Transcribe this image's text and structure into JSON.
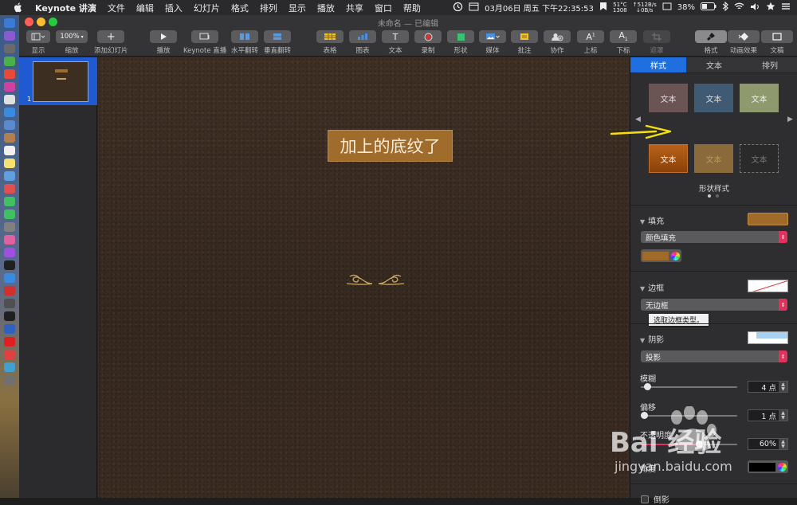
{
  "menubar": {
    "app": "Keynote 讲演",
    "items": [
      "文件",
      "编辑",
      "插入",
      "幻灯片",
      "格式",
      "排列",
      "显示",
      "播放",
      "共享",
      "窗口",
      "帮助"
    ],
    "clock": "03月06日 周五 下午22:35:53",
    "temp": "51°C",
    "rpm": "1308",
    "net_up": "↑512B/s",
    "net_down": "↓0B/s",
    "battery": "38%"
  },
  "window": {
    "title": "未命名 — 已编辑"
  },
  "toolbar": {
    "view": "显示",
    "zoom_value": "100%",
    "zoom": "缩放",
    "add_slide": "添加幻灯片",
    "play": "播放",
    "keynote_live": "Keynote 直播",
    "flip_h": "水平翻转",
    "flip_v": "垂直翻转",
    "table": "表格",
    "chart": "图表",
    "text": "文本",
    "record": "录制",
    "shape": "形状",
    "media": "媒体",
    "comment": "批注",
    "collaborate": "协作",
    "superscript": "上标",
    "subscript": "下标",
    "mask": "遮罩",
    "format": "格式",
    "animate": "动画效果",
    "document": "文稿"
  },
  "navigator": {
    "slide_number": "1"
  },
  "slide": {
    "text": "加上的底纹了"
  },
  "inspector": {
    "tabs": [
      "样式",
      "文本",
      "排列"
    ],
    "styles": [
      {
        "label": "文本",
        "bg": "#6b5454"
      },
      {
        "label": "文本",
        "bg": "#405a74"
      },
      {
        "label": "文本",
        "bg": "#8e9a6e"
      },
      {
        "label": "文本",
        "bg": "#a35a12"
      },
      {
        "label": "文本",
        "bg": "#8a6a3a"
      },
      {
        "label": "文本",
        "bg": "#2a2a2a"
      }
    ],
    "shape_styles": "形状样式",
    "fill_label": "填充",
    "fill_color": "#a06a2a",
    "fill_type": "颜色填充",
    "border_label": "边框",
    "border_type": "无边框",
    "border_tooltip": "选取边框类型。",
    "shadow_label": "阴影",
    "shadow_type": "投影",
    "blur_label": "模糊",
    "blur_value": "4 点",
    "blur_level": 0.07,
    "offset_label": "偏移",
    "offset_value": "1 点",
    "offset_level": 0.03,
    "opacity_label": "不透明度",
    "opacity_value": "60%",
    "opacity_level": 0.6,
    "angle_label": "角度",
    "reflection_label": "倒影"
  },
  "watermark": {
    "brand": "Bai 经验",
    "url": "jingyan.baidu.com"
  }
}
